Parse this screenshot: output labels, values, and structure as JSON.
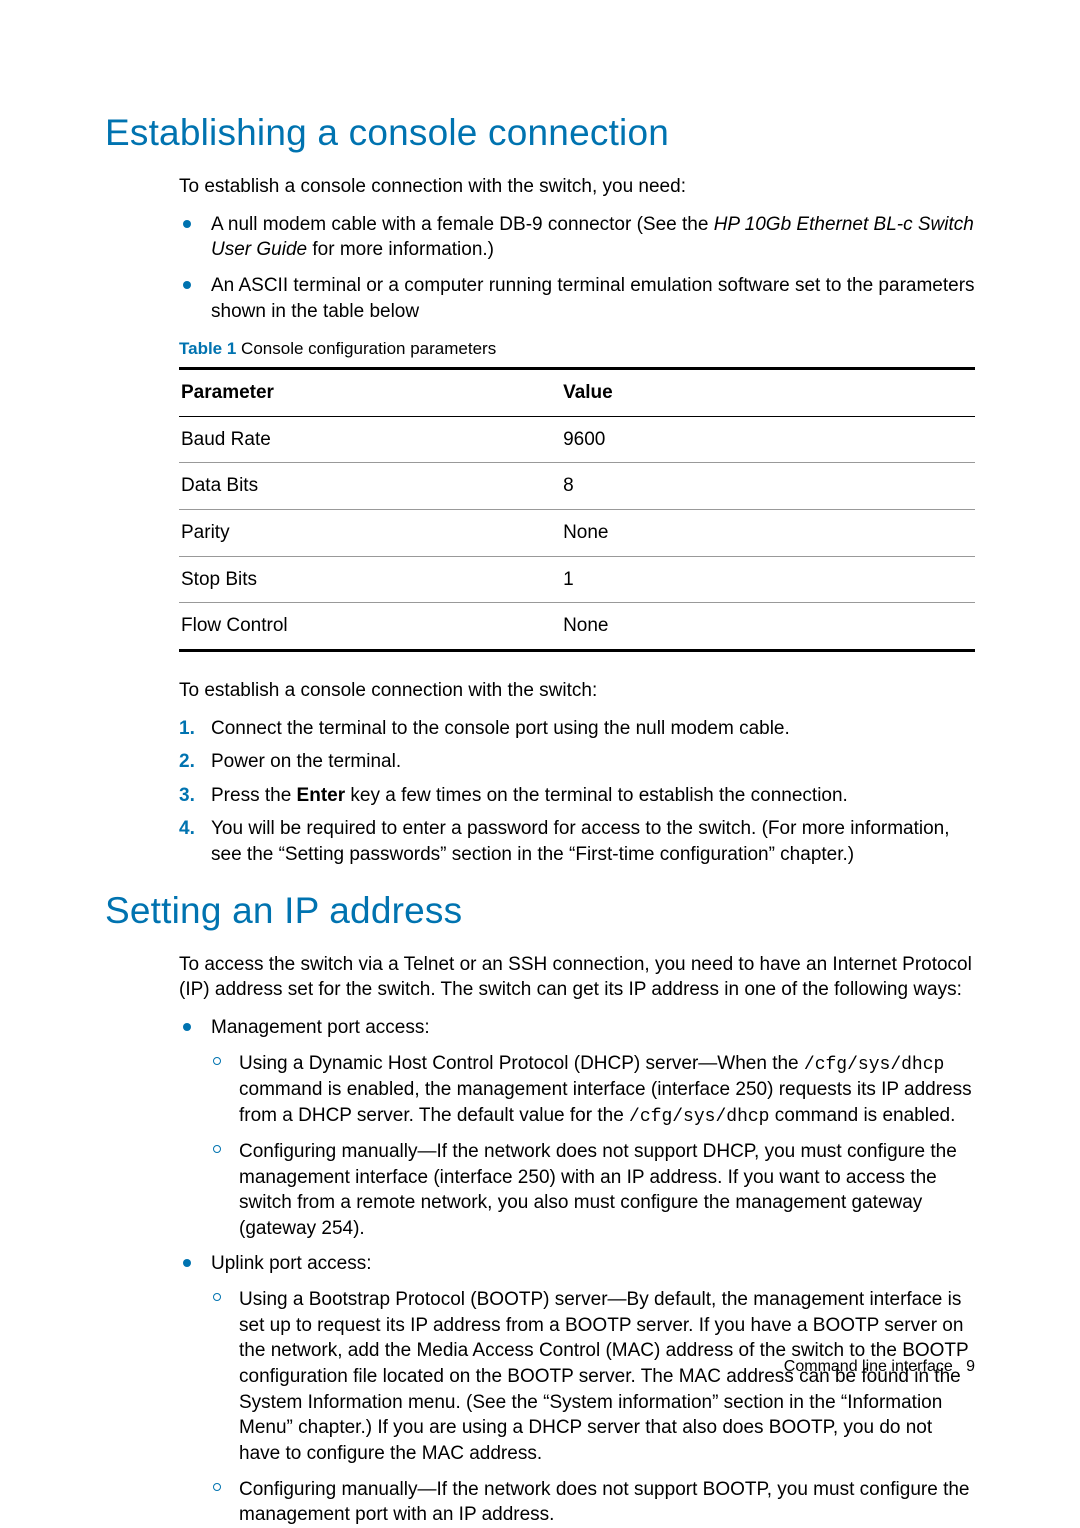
{
  "headings": {
    "h1a": "Establishing a console connection",
    "h1b": "Setting an IP address"
  },
  "sectionA": {
    "intro": "To establish a console connection with the switch, you need:",
    "bullets": {
      "b1_pre": "A null modem cable with a female DB-9 connector (See the ",
      "b1_em": "HP 10Gb Ethernet BL-c Switch User Guide",
      "b1_post": " for more information.)",
      "b2": "An ASCII terminal or a computer running terminal emulation software set to the parameters shown in the table below"
    },
    "table_caption_label": "Table 1",
    "table_caption_text": "  Console configuration parameters",
    "table": {
      "head_param": "Parameter",
      "head_value": "Value",
      "rows": [
        {
          "param": "Baud Rate",
          "value": "9600"
        },
        {
          "param": "Data Bits",
          "value": "8"
        },
        {
          "param": "Parity",
          "value": "None"
        },
        {
          "param": "Stop Bits",
          "value": "1"
        },
        {
          "param": "Flow Control",
          "value": "None"
        }
      ]
    },
    "steps_intro": "To establish a console connection with the switch:",
    "steps": {
      "s1": "Connect the terminal to the console port using the null modem cable.",
      "s2": "Power on the terminal.",
      "s3_pre": "Press the ",
      "s3_bold": "Enter",
      "s3_post": " key a few times on the terminal to establish the connection.",
      "s4": "You will be required to enter a password for access to the switch. (For more information, see the “Setting passwords” section in the “First-time configuration” chapter.)"
    }
  },
  "sectionB": {
    "intro": "To access the switch via a Telnet or an SSH connection, you need to have an Internet Protocol (IP) address set for the switch. The switch can get its IP address in one of the following ways:",
    "mgmt_label": "Management port access:",
    "mgmt_sub1_pre": "Using a Dynamic Host Control Protocol (DHCP) server—When the ",
    "mgmt_sub1_code1": "/cfg/sys/dhcp",
    "mgmt_sub1_mid": " command is enabled, the management interface (interface 250) requests its IP address from a DHCP server. The default value for the ",
    "mgmt_sub1_code2": "/cfg/sys/dhcp",
    "mgmt_sub1_post": " command is enabled.",
    "mgmt_sub2": "Configuring manually—If the network does not support DHCP, you must configure the management interface (interface 250) with an IP address. If you want to access the switch from a remote network, you also must configure the management gateway (gateway 254).",
    "uplink_label": "Uplink port access:",
    "uplink_sub1": "Using a Bootstrap Protocol (BOOTP) server—By default, the management interface is set up to request its IP address from a BOOTP server. If you have a BOOTP server on the network, add the Media Access Control (MAC) address of the switch to the BOOTP configuration file located on the BOOTP server. The MAC address can be found in the System Information menu. (See the “System information” section in the “Information Menu” chapter.) If you are using a DHCP server that also does BOOTP, you do not have to configure the MAC address.",
    "uplink_sub2": "Configuring manually—If the network does not support BOOTP, you must configure the management port with an IP address."
  },
  "footer": {
    "text": "Command line interface",
    "page": "9"
  }
}
